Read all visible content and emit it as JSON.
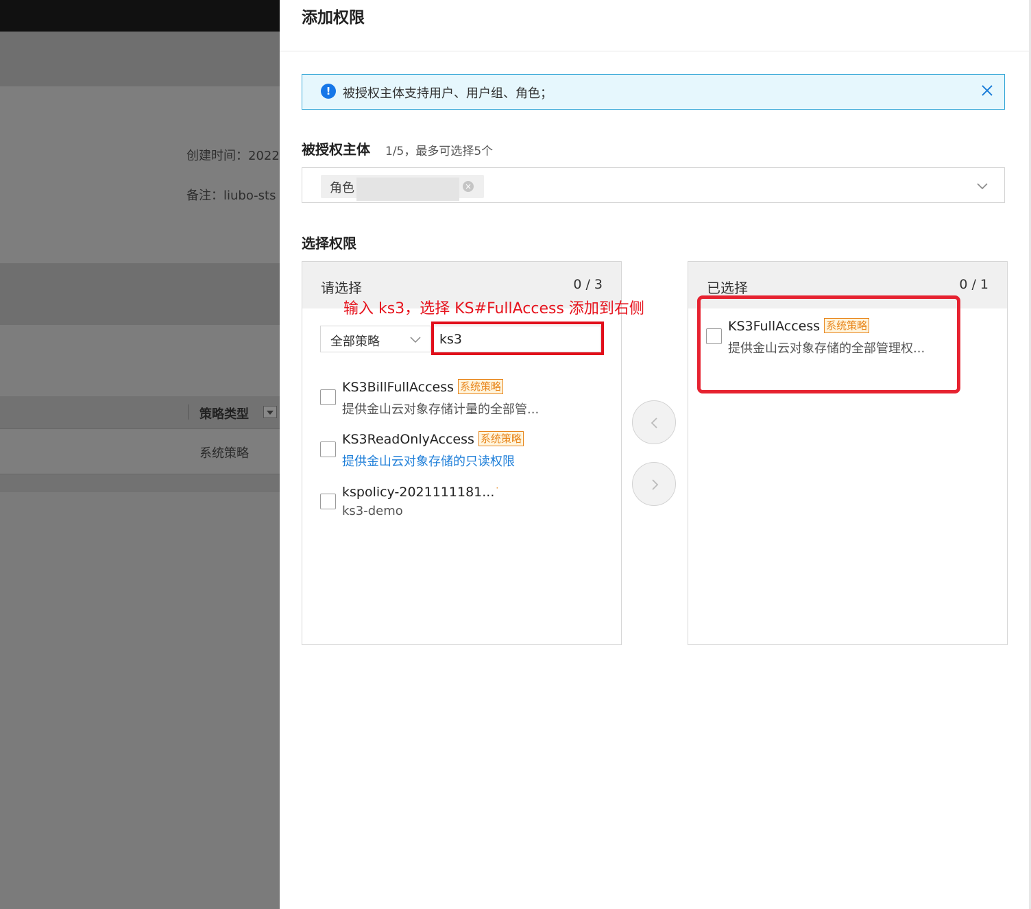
{
  "background": {
    "created_time_label": "创建时间：2022",
    "remark_label": "备注：liubo-sts",
    "table_header_policy_type": "策略类型",
    "table_cell_policy_type": "系统策略"
  },
  "drawer": {
    "title": "添加权限",
    "alert": {
      "text": "被授权主体支持用户、用户组、角色；"
    },
    "principal": {
      "label": "被授权主体",
      "note": "1/5，最多可选择5个",
      "tag_text": "角色"
    },
    "permissions_label": "选择权限",
    "left_panel": {
      "title": "请选择",
      "count": "0 / 3",
      "annotation": "输入 ks3，选择 KS#FullAccess 添加到右侧",
      "filter_value": "全部策略",
      "search_value": "ks3",
      "items": [
        {
          "name": "KS3BillFullAccess",
          "badge": "系统策略",
          "desc": "提供金山云对象存储计量的全部管..."
        },
        {
          "name": "KS3ReadOnlyAccess",
          "badge": "系统策略",
          "desc": "提供金山云对象存储的只读权限"
        },
        {
          "name": "kspolicy-2021111181...",
          "badge": "",
          "desc": "ks3-demo"
        }
      ]
    },
    "right_panel": {
      "title": "已选择",
      "count": "0 / 1",
      "items": [
        {
          "name": "KS3FullAccess",
          "badge": "系统策略",
          "desc": "提供金山云对象存储的全部管理权..."
        }
      ]
    }
  },
  "colors": {
    "accent": "#1677e8",
    "annotation_red": "#e10e1a",
    "badge_orange": "#e8861c",
    "link_blue": "#1f7fd9"
  }
}
